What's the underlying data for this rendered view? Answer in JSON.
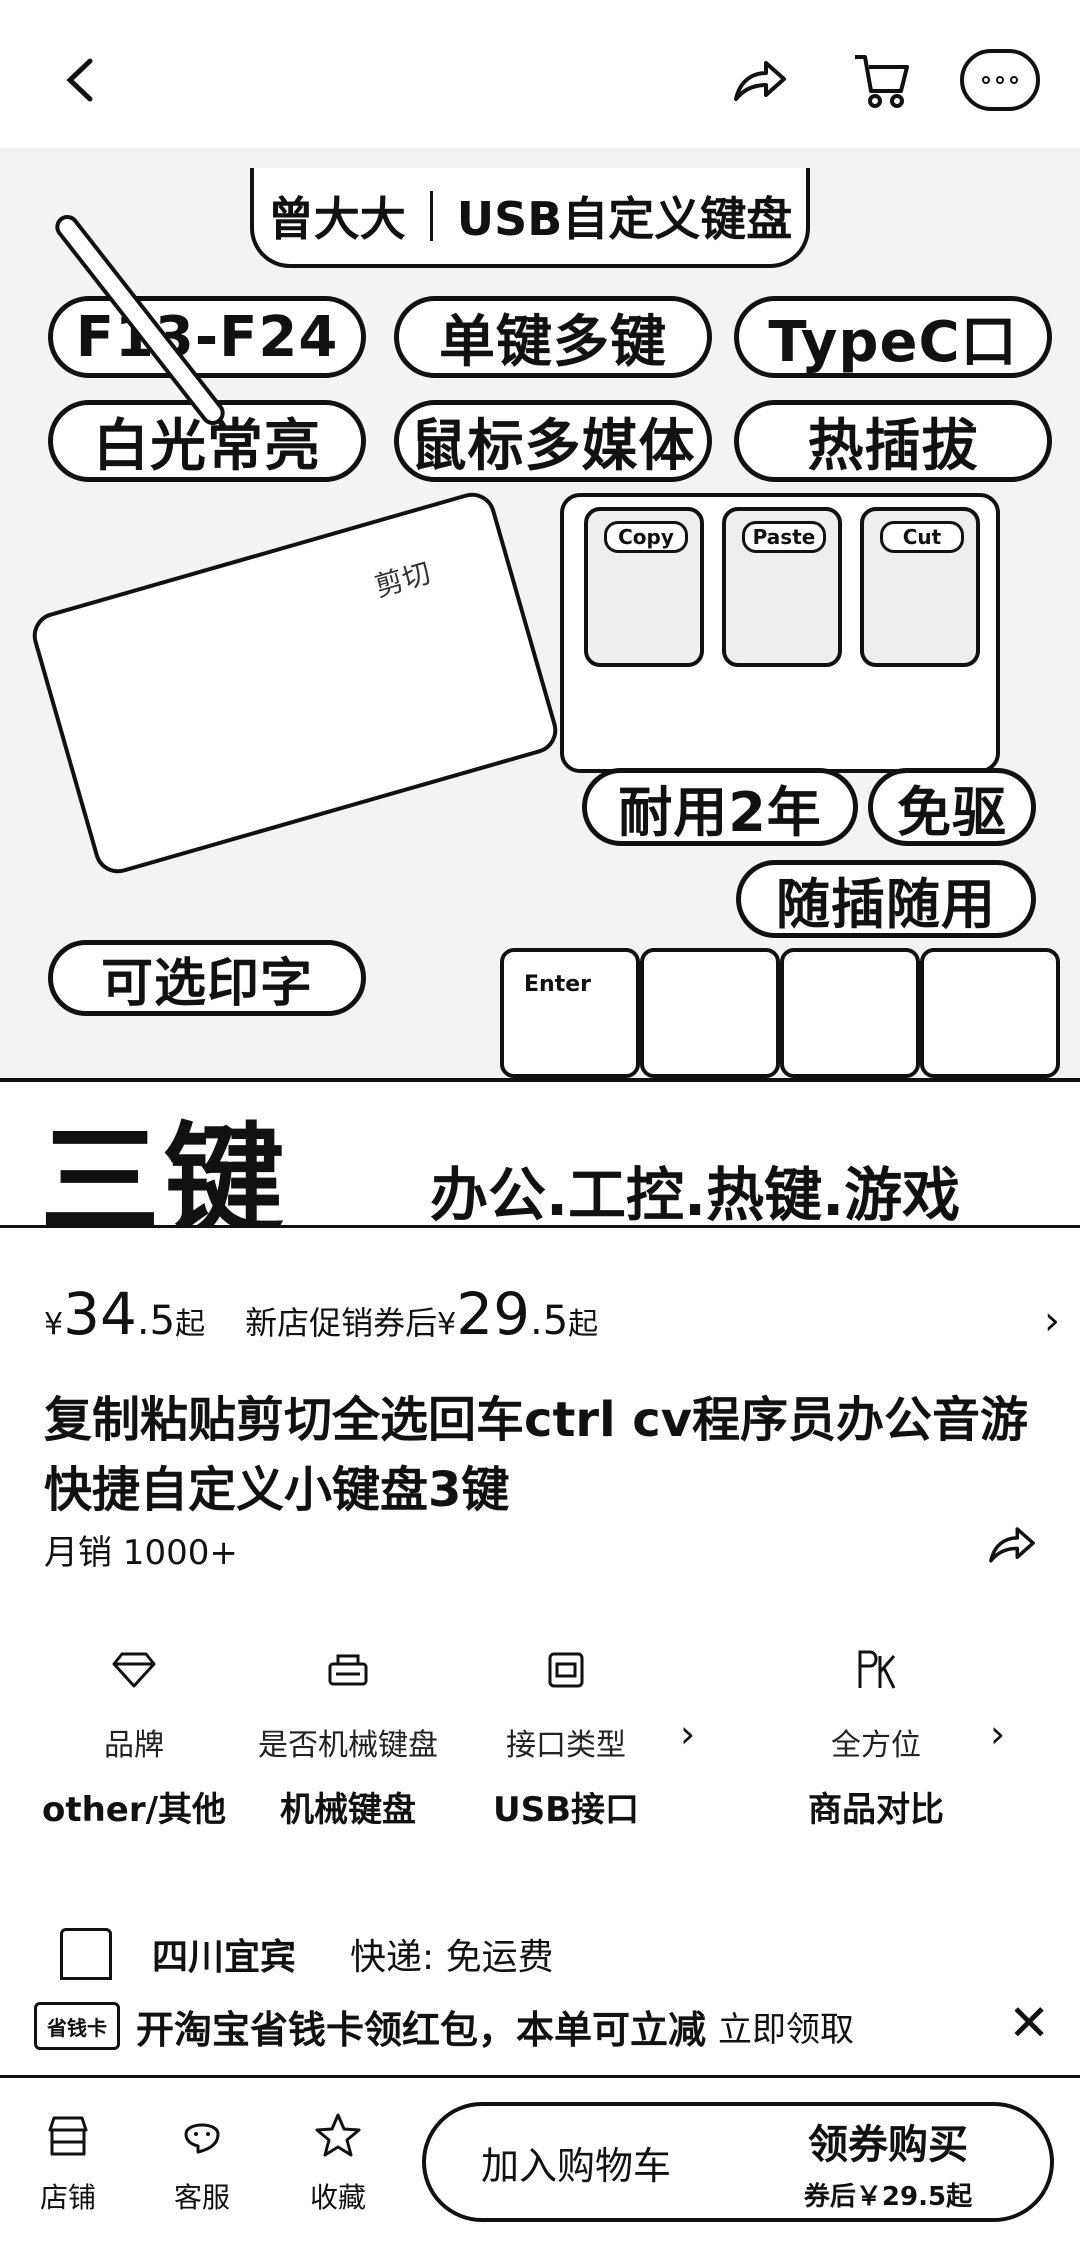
{
  "nav": {
    "back_icon": "chevron-left-icon",
    "share_icon": "share-icon",
    "cart_icon": "cart-icon",
    "more_icon": "more-bubble-icon"
  },
  "hero": {
    "brand": "曾大大",
    "product_type": "USB自定义键盘",
    "feature_pills": [
      "F13-F24",
      "单键多键",
      "TypeC口",
      "白光常亮",
      "鼠标多媒体",
      "热插拔"
    ],
    "badge_durable": "耐用2年",
    "badge_driverless": "免驱",
    "badge_plug": "随插随用",
    "badge_print": "可选印字",
    "keycaps": [
      "Copy",
      "Paste",
      "Cut"
    ],
    "enter_key": "Enter",
    "left_pad_labels": [
      "剪切"
    ],
    "big_title": "三键",
    "tagline": "办公.工控.热键.游戏"
  },
  "price": {
    "currency": "¥",
    "integer": "34",
    "decimal": ".5",
    "suffix": "起",
    "promo_label": "新店促销券后",
    "promo_currency": "¥",
    "promo_integer": "29",
    "promo_decimal": ".5",
    "promo_suffix": "起"
  },
  "title": "复制粘贴剪切全选回车ctrl cv程序员办公音游快捷自定义小键盘3键",
  "monthly_sales": "月销 1000+",
  "specs": [
    {
      "icon": "diamond-icon",
      "label": "品牌",
      "value": "other/其他"
    },
    {
      "icon": "keyboard-icon",
      "label": "是否机械键盘",
      "value": "机械键盘"
    },
    {
      "icon": "port-icon",
      "label": "接口类型",
      "value": "USB接口"
    },
    {
      "icon": "pk-icon",
      "label": "全方位",
      "value": "商品对比"
    }
  ],
  "shipping": {
    "location": "四川宜宾",
    "express": "快递: 免运费"
  },
  "banner": {
    "badge": "省钱卡",
    "text": "开淘宝省钱卡领红包，本单可立减",
    "action": "立即领取"
  },
  "bottom": {
    "tabs": [
      {
        "icon": "store-icon",
        "label": "店铺"
      },
      {
        "icon": "service-icon",
        "label": "客服"
      },
      {
        "icon": "star-icon",
        "label": "收藏"
      }
    ],
    "add_to_cart": "加入购物车",
    "buy_label": "领券购买",
    "buy_sub": "券后￥29.5起"
  }
}
